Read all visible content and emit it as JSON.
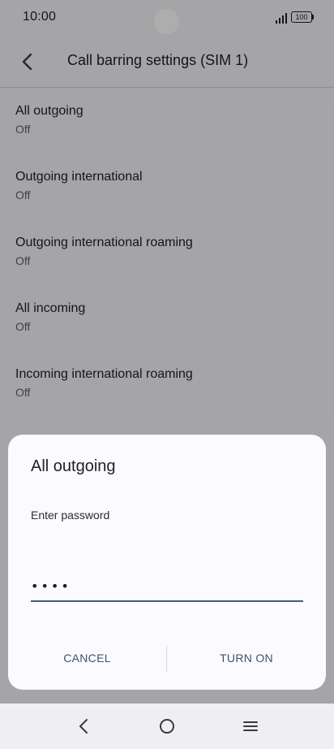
{
  "status_bar": {
    "time": "10:00",
    "battery_level": "100",
    "icons": [
      "signal-icon",
      "battery-icon"
    ]
  },
  "header": {
    "title": "Call barring settings (SIM 1)",
    "back_icon": "chevron-left-icon"
  },
  "settings": {
    "items": [
      {
        "title": "All outgoing",
        "value": "Off"
      },
      {
        "title": "Outgoing international",
        "value": "Off"
      },
      {
        "title": "Outgoing international roaming",
        "value": "Off"
      },
      {
        "title": "All incoming",
        "value": "Off"
      },
      {
        "title": "Incoming international roaming",
        "value": "Off"
      }
    ]
  },
  "dialog": {
    "title": "All outgoing",
    "label": "Enter password",
    "password_value": "••••",
    "cancel_label": "CANCEL",
    "confirm_label": "TURN ON"
  },
  "nav_bar": {
    "icons": [
      "back-triangle-icon",
      "home-circle-icon",
      "menu-lines-icon"
    ]
  },
  "colors": {
    "accent": "#3f5272",
    "surface": "#fbfafe",
    "background": "#f4f3f8"
  }
}
